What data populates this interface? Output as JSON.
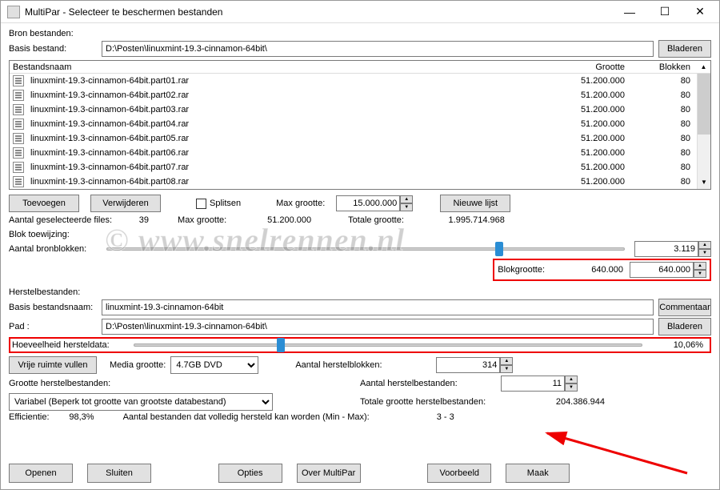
{
  "window": {
    "title": "MultiPar - Selecteer te beschermen bestanden"
  },
  "source": {
    "section": "Bron bestanden:",
    "base_label": "Basis bestand:",
    "base_value": "D:\\Posten\\linuxmint-19.3-cinnamon-64bit\\",
    "browse": "Bladeren"
  },
  "filelist": {
    "col_name": "Bestandsnaam",
    "col_size": "Grootte",
    "col_blocks": "Blokken",
    "rows": [
      {
        "name": "linuxmint-19.3-cinnamon-64bit.part01.rar",
        "size": "51.200.000",
        "blocks": "80"
      },
      {
        "name": "linuxmint-19.3-cinnamon-64bit.part02.rar",
        "size": "51.200.000",
        "blocks": "80"
      },
      {
        "name": "linuxmint-19.3-cinnamon-64bit.part03.rar",
        "size": "51.200.000",
        "blocks": "80"
      },
      {
        "name": "linuxmint-19.3-cinnamon-64bit.part04.rar",
        "size": "51.200.000",
        "blocks": "80"
      },
      {
        "name": "linuxmint-19.3-cinnamon-64bit.part05.rar",
        "size": "51.200.000",
        "blocks": "80"
      },
      {
        "name": "linuxmint-19.3-cinnamon-64bit.part06.rar",
        "size": "51.200.000",
        "blocks": "80"
      },
      {
        "name": "linuxmint-19.3-cinnamon-64bit.part07.rar",
        "size": "51.200.000",
        "blocks": "80"
      },
      {
        "name": "linuxmint-19.3-cinnamon-64bit.part08.rar",
        "size": "51.200.000",
        "blocks": "80"
      }
    ]
  },
  "filebtns": {
    "add": "Toevoegen",
    "remove": "Verwijderen",
    "split": "Splitsen",
    "maxsize_label": "Max grootte:",
    "maxsize_value": "15.000.000",
    "newlist": "Nieuwe lijst"
  },
  "stats": {
    "selected_label": "Aantal geselecteerde files:",
    "selected_value": "39",
    "maxsize_label": "Max grootte:",
    "maxsize_value": "51.200.000",
    "total_label": "Totale grootte:",
    "total_value": "1.995.714.968"
  },
  "block": {
    "section": "Blok toewijzing:",
    "srcblocks_label": "Aantal bronblokken:",
    "srcblocks_value": "3.119",
    "blocksize_label": "Blokgrootte:",
    "blocksize_mid": "640.000",
    "blocksize_value": "640.000"
  },
  "recovery": {
    "section": "Herstelbestanden:",
    "basename_label": "Basis bestandsnaam:",
    "basename_value": "linuxmint-19.3-cinnamon-64bit",
    "comment": "Commentaar",
    "path_label": "Pad :",
    "path_value": "D:\\Posten\\linuxmint-19.3-cinnamon-64bit\\",
    "browse": "Bladeren",
    "amount_label": "Hoeveelheid hersteldata:",
    "amount_value": "10,06%",
    "fillfree": "Vrije ruimte vullen",
    "media_label": "Media grootte:",
    "media_value": "4.7GB DVD",
    "recblocks_label": "Aantal herstelblokken:",
    "recblocks_value": "314",
    "recfiles_label": "Aantal herstelbestanden:",
    "recfiles_value": "11",
    "sizefiles_label": "Grootte herstelbestanden:",
    "totalsize_label": "Totale grootte herstelbestanden:",
    "totalsize_value": "204.386.944",
    "sizing_value": "Variabel (Beperk tot grootte van grootste databestand)",
    "eff_label": "Efficientie:",
    "eff_value": "98,3%",
    "fullrec_label": "Aantal bestanden dat volledig hersteld kan worden (Min - Max):",
    "fullrec_value": "3 - 3"
  },
  "footer": {
    "open": "Openen",
    "close": "Sluiten",
    "options": "Opties",
    "about": "Over MultiPar",
    "preview": "Voorbeeld",
    "create": "Maak"
  },
  "watermark": "© www.snelrennen.nl"
}
